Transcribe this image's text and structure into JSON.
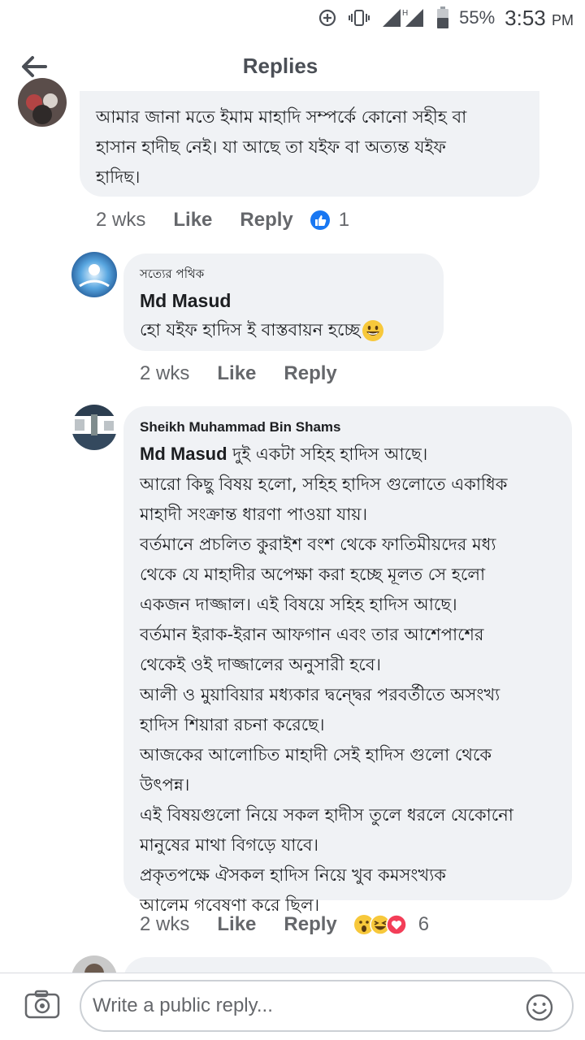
{
  "status_bar": {
    "battery": "55%",
    "time": "3:53",
    "ampm": "PM",
    "network": "H"
  },
  "header": {
    "title": "Replies"
  },
  "comments": [
    {
      "text": "আমার জানা মতে ইমাম মাহাদি সম্পর্কে কোনো সহীহ বা\nহাসান হাদীছ নেই। যা আছে তা যইফ বা অত্যন্ত যইফ\nহাদিছ।",
      "time": "2 wks",
      "like": "Like",
      "reply": "Reply",
      "reactions": "1"
    },
    {
      "flair": "সত্যের পথিক",
      "author": "Md Masud",
      "text": "হো যইফ হাদিস ই বাস্তবায়ন হচ্ছে",
      "time": "2 wks",
      "like": "Like",
      "reply": "Reply"
    },
    {
      "author": "Sheikh Muhammad Bin Shams",
      "mention": "Md Masud",
      "first_line": " দুই একটা সহিহ হাদিস আছে।",
      "text": "আরো কিছু বিষয় হলো, সহিহ হাদিস গুলোতে একাধিক\nমাহাদী সংক্রান্ত ধারণা পাওয়া যায়।\nবর্তমানে প্রচলিত কুরাইশ বংশ থেকে ফাতিমীয়দের মধ্য\nথেকে যে মাহাদীর অপেক্ষা করা হচ্ছে মূলত সে হলো\nএকজন দাজ্জাল। এই বিষয়ে সহিহ হাদিস আছে।\nবর্তমান ইরাক-ইরান আফগান এবং তার আশেপাশের\nথেকেই ওই দাজ্জালের অনুসারী হবে।\nআলী ও মুয়াবিয়ার মধ্যকার দ্বন্দ্বের পরবর্তীতে অসংখ্য\nহাদিস শিয়ারা রচনা করেছে।\nআজকের আলোচিত মাহাদী সেই হাদিস গুলো থেকে\nউৎপন্ন।\nএই বিষয়গুলো নিয়ে সকল হাদীস তুলে ধরলে যেকোনো\nমানুষের মাথা বিগড়ে যাবে।\nপ্রকৃতপক্ষে ঐসকল হাদিস নিয়ে খুব কমসংখ্যক\nআলেম গবেষণা করে ছিল।",
      "time": "2 wks",
      "like": "Like",
      "reply": "Reply",
      "reactions": "6"
    }
  ],
  "composer": {
    "placeholder": "Write a public reply..."
  },
  "colors": {
    "bubble": "#f0f2f5",
    "like_blue": "#1877f2",
    "meta_gray": "#65676b"
  },
  "icons": [
    "back-arrow-icon",
    "camera-icon",
    "smiley-icon",
    "like-reaction-icon",
    "wow-reaction-icon",
    "haha-reaction-icon",
    "love-reaction-icon",
    "grinning-emoji-icon"
  ]
}
